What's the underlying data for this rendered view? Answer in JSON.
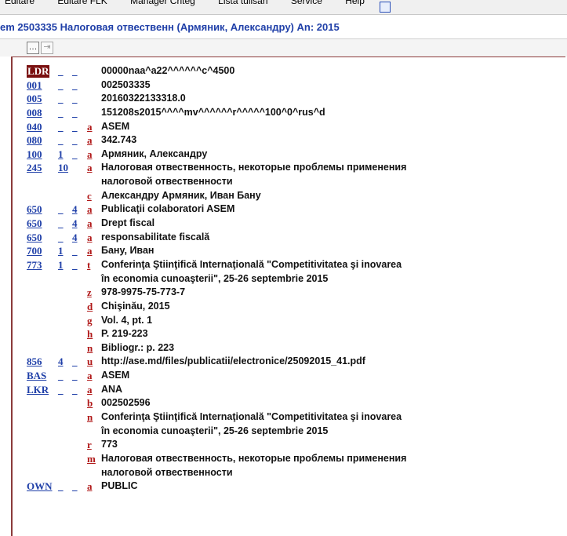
{
  "menubar": {
    "items": [
      "Editare",
      "Editare FLK",
      "Manager Criteg",
      "Lista tulisari",
      "Service",
      "Help"
    ]
  },
  "window": {
    "title": "em 2503335 Налоговая отвественн  (Армяник, Александру) An: 2015"
  },
  "toolbar": {
    "btn1": "…",
    "btn2": "⇥"
  },
  "record": {
    "rows": [
      {
        "tag": "LDR",
        "ind1": "_",
        "ind2": "_",
        "sub": "",
        "value": "00000naa^a22^^^^^^c^4500"
      },
      {
        "tag": "001",
        "ind1": "_",
        "ind2": "_",
        "sub": "",
        "value": "002503335"
      },
      {
        "tag": "005",
        "ind1": "_",
        "ind2": "_",
        "sub": "",
        "value": "20160322133318.0"
      },
      {
        "tag": "008",
        "ind1": "_",
        "ind2": "_",
        "sub": "",
        "value": "151208s2015^^^^mv^^^^^^r^^^^^100^0^rus^d"
      },
      {
        "tag": "040",
        "ind1": "_",
        "ind2": "_",
        "sub": "a",
        "value": "ASEM"
      },
      {
        "tag": "080",
        "ind1": "_",
        "ind2": "_",
        "sub": "a",
        "value": "342.743"
      },
      {
        "tag": "100",
        "ind1": "1",
        "ind2": "_",
        "sub": "a",
        "value": "Армяник, Александру"
      },
      {
        "tag": "245",
        "ind1": "10",
        "ind2": "",
        "sub": "a",
        "value": "Налоговая отвественность, некоторые проблемы применения"
      },
      {
        "tag": "",
        "ind1": "",
        "ind2": "",
        "sub": "",
        "value": "налоговой отвественности"
      },
      {
        "tag": "",
        "ind1": "",
        "ind2": "",
        "sub": "c",
        "value": "Александру Армяник, Иван Бану"
      },
      {
        "tag": "650",
        "ind1": "_",
        "ind2": "4",
        "sub": "a",
        "value": "Publicaţii colaboratori ASEM"
      },
      {
        "tag": "650",
        "ind1": "_",
        "ind2": "4",
        "sub": "a",
        "value": "Drept fiscal"
      },
      {
        "tag": "650",
        "ind1": "_",
        "ind2": "4",
        "sub": "a",
        "value": "responsabilitate fiscală"
      },
      {
        "tag": "700",
        "ind1": "1",
        "ind2": "_",
        "sub": "a",
        "value": "Бану, Иван"
      },
      {
        "tag": "773",
        "ind1": "1",
        "ind2": "_",
        "sub": "t",
        "value": "Conferinţa Ştiinţifică Internaţională \"Competitivitatea şi inovarea"
      },
      {
        "tag": "",
        "ind1": "",
        "ind2": "",
        "sub": "",
        "value": "în economia cunoaşterii\", 25-26 septembrie 2015"
      },
      {
        "tag": "",
        "ind1": "",
        "ind2": "",
        "sub": "z",
        "value": "978-9975-75-773-7"
      },
      {
        "tag": "",
        "ind1": "",
        "ind2": "",
        "sub": "d",
        "value": "Chişinău, 2015"
      },
      {
        "tag": "",
        "ind1": "",
        "ind2": "",
        "sub": "g",
        "value": "Vol. 4, pt. 1"
      },
      {
        "tag": "",
        "ind1": "",
        "ind2": "",
        "sub": "h",
        "value": "P. 219-223"
      },
      {
        "tag": "",
        "ind1": "",
        "ind2": "",
        "sub": "n",
        "value": "Bibliogr.: p. 223"
      },
      {
        "tag": "856",
        "ind1": "4",
        "ind2": "_",
        "sub": "u",
        "value": "http://ase.md/files/publicatii/electronice/25092015_41.pdf"
      },
      {
        "tag": "BAS",
        "ind1": "_",
        "ind2": "_",
        "sub": "a",
        "value": "ASEM"
      },
      {
        "tag": "LKR",
        "ind1": "_",
        "ind2": "_",
        "sub": "a",
        "value": "ANA"
      },
      {
        "tag": "",
        "ind1": "",
        "ind2": "",
        "sub": "b",
        "value": "002502596"
      },
      {
        "tag": "",
        "ind1": "",
        "ind2": "",
        "sub": "n",
        "value": "Conferinţa Ştiinţifică Internaţională \"Competitivitatea şi inovarea"
      },
      {
        "tag": "",
        "ind1": "",
        "ind2": "",
        "sub": "",
        "value": "în economia cunoaşterii\", 25-26 septembrie 2015"
      },
      {
        "tag": "",
        "ind1": "",
        "ind2": "",
        "sub": "r",
        "value": "773"
      },
      {
        "tag": "",
        "ind1": "",
        "ind2": "",
        "sub": "m",
        "value": "Налоговая отвественность, некоторые проблемы применения"
      },
      {
        "tag": "",
        "ind1": "",
        "ind2": "",
        "sub": "",
        "value": "налоговой отвественности"
      },
      {
        "tag": "OWN",
        "ind1": "_",
        "ind2": "_",
        "sub": "a",
        "value": "PUBLIC"
      }
    ]
  },
  "colors": {
    "tag": "#1f3fa8",
    "subfield": "#b01818",
    "ldr_bg": "#7a1010",
    "panel_border": "#8b3a3a",
    "title": "#1f3fa8"
  }
}
